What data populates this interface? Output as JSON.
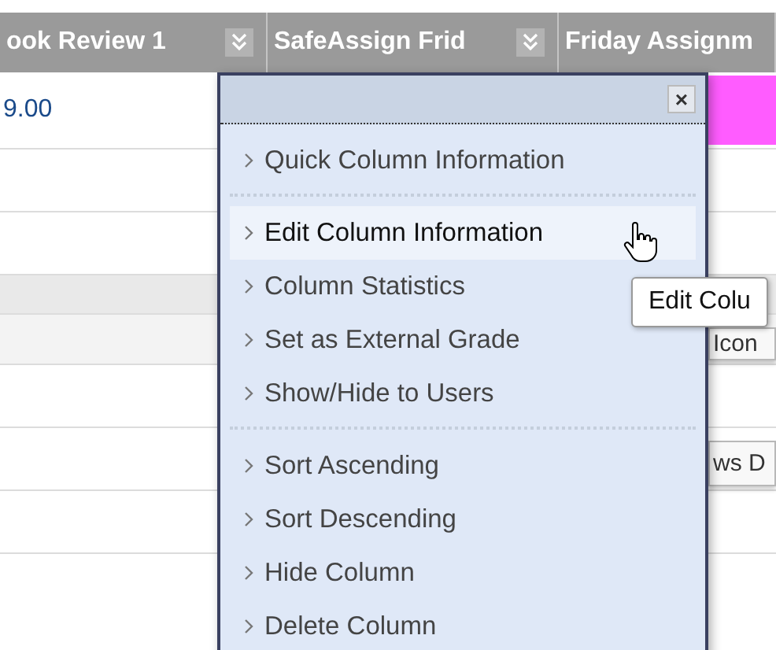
{
  "table": {
    "columns": [
      {
        "label": "ook Review 1",
        "menu": true
      },
      {
        "label": "SafeAssign Frid",
        "menu": true
      },
      {
        "label": "Friday Assignm",
        "menu": false
      }
    ],
    "rows": [
      {
        "kind": "tall",
        "cell_1": "9.00",
        "highlighted": true
      },
      {
        "kind": "plain",
        "highlighted": false
      },
      {
        "kind": "plain",
        "highlighted": false
      },
      {
        "kind": "band",
        "highlighted": false
      },
      {
        "kind": "shaded",
        "cell_3": "Icon"
      },
      {
        "kind": "plain",
        "highlighted": false
      },
      {
        "kind": "plain",
        "cell_3": "ws D"
      },
      {
        "kind": "plain",
        "highlighted": false
      }
    ]
  },
  "menu": {
    "close": "×",
    "groups": [
      {
        "items": [
          {
            "label": "Quick Column Information",
            "selected": false
          }
        ]
      },
      {
        "items": [
          {
            "label": "Edit Column Information",
            "selected": true
          },
          {
            "label": "Column Statistics",
            "selected": false
          },
          {
            "label": "Set as External Grade",
            "selected": false
          },
          {
            "label": "Show/Hide to Users",
            "selected": false
          }
        ]
      },
      {
        "items": [
          {
            "label": "Sort Ascending",
            "selected": false
          },
          {
            "label": "Sort Descending",
            "selected": false
          },
          {
            "label": "Hide Column",
            "selected": false
          },
          {
            "label": "Delete Column",
            "selected": false
          }
        ]
      }
    ]
  },
  "tooltip": "Edit Colu"
}
